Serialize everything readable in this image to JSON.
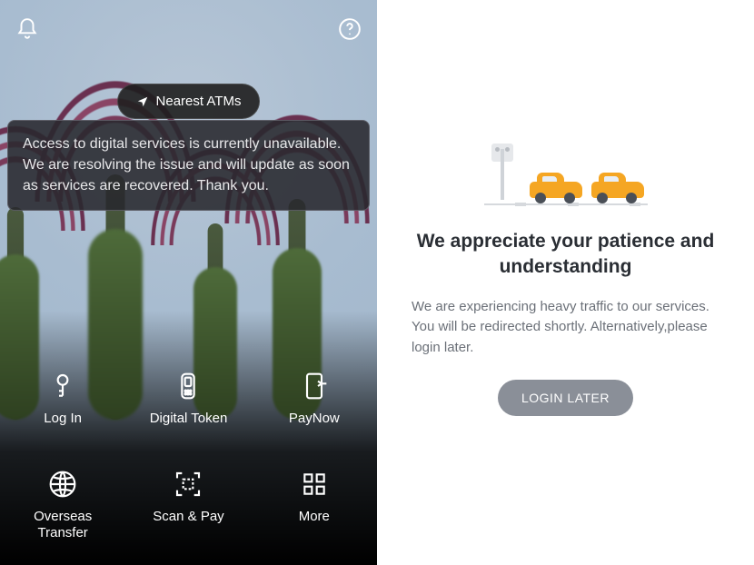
{
  "left": {
    "nearest_atms": "Nearest ATMs",
    "banner": "Access to digital services is currently unavailable. We are resolving the issue and will update as soon as services are recovered. Thank you.",
    "actions": {
      "login": "Log In",
      "digital_token": "Digital Token",
      "paynow": "PayNow",
      "overseas": "Overseas Transfer",
      "scan_pay": "Scan & Pay",
      "more": "More"
    }
  },
  "right": {
    "title": "We appreciate your patience and understanding",
    "body": "We are experiencing heavy traffic to our services. You will be redirected shortly. Alternatively,please login later.",
    "button": "LOGIN LATER"
  }
}
